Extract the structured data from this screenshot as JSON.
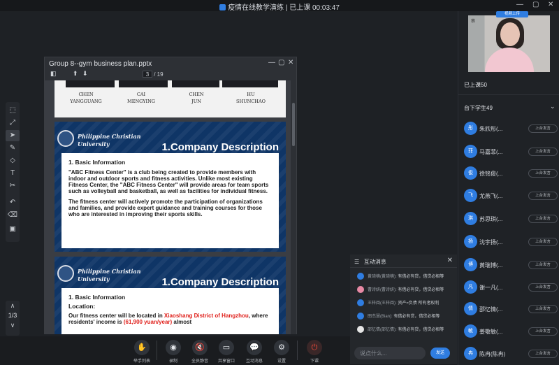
{
  "window": {
    "title": "疫情在线教学演练 | 已上课 00:03:47",
    "min": "—",
    "restore": "▢",
    "close": "✕"
  },
  "doc": {
    "title": "Group 8--gym business plan.pptx",
    "page_current": "3",
    "page_total": "/ 19",
    "min": "—",
    "max": "▢",
    "close": "✕",
    "people": [
      {
        "first": "CHEN",
        "last": "YANGGUANG"
      },
      {
        "first": "CAI",
        "last": "MENGYING"
      },
      {
        "first": "CHEN",
        "last": "JUN"
      },
      {
        "first": "HU",
        "last": "SHUNCHAO"
      }
    ],
    "slide2": {
      "school_line1": "Philippine Christian",
      "school_line2": "University",
      "heading": "1.Company Description",
      "sub": "1. Basic Information",
      "para1": "\"ABC Fitness Center\" is a club being created to provide members with indoor and outdoor sports and fitness activities. Unlike most existing Fitness Center, the \"ABC Fitness Center\" will provide areas for team sports such as volleyball and basketball, as well as facilities for individual fitness.",
      "para2": "The fitness center will actively promote the participation of organizations and families, and provide expert guidance and training courses for those who are interested in improving their sports skills."
    },
    "slide3": {
      "school_line1": "Philippine Christian",
      "school_line2": "University",
      "heading": "1.Company Description",
      "sub": "1. Basic Information",
      "location": "Location:",
      "text_a": "Our fitness center will be located in ",
      "text_b": "Xiaoshang District of Hangzhou",
      "text_c": ", where residents' income is ",
      "text_d": "(61,900 yuan/year)",
      "text_e": " almost"
    }
  },
  "pager": {
    "up": "∧",
    "label": "1/3",
    "down": "∨"
  },
  "toolbar": [
    {
      "icon": "hand-icon",
      "glyph": "✋",
      "label": "举手列表"
    },
    {
      "icon": "record-icon",
      "glyph": "◉",
      "label": "录制"
    },
    {
      "icon": "mute-all-icon",
      "glyph": "🔇",
      "label": "全员静音"
    },
    {
      "icon": "share-screen-icon",
      "glyph": "▭",
      "label": "共享窗口"
    },
    {
      "icon": "interaction-icon",
      "glyph": "💬",
      "label": "互动消息"
    },
    {
      "icon": "settings-icon",
      "glyph": "⚙",
      "label": "设置"
    },
    {
      "icon": "end-class-icon",
      "glyph": "⏻",
      "label": "下课"
    }
  ],
  "chat": {
    "header": "互动消息",
    "placeholder": "说点什么...",
    "send": "发送",
    "messages": [
      {
        "name": "黄琦楠(黄琦楠):",
        "text": "有借必有贷，借贷必相等"
      },
      {
        "name": "曹诗妍(曹诗妍):",
        "text": "有借必有贷，借贷必相等"
      },
      {
        "name": "王梓阅(王梓阅):",
        "text": "资产=负债 所有者权利"
      },
      {
        "name": "田杰慧(Bian):",
        "text": "有借必有贷，借贷必相等"
      },
      {
        "name": "邵忆情(邵忆情):",
        "text": "有借必有贷，借贷必相等"
      }
    ]
  },
  "right": {
    "upload_tag": "视频上传",
    "video_label": "蔡",
    "in_class": "已上课50",
    "students_header": "台下学生49",
    "chevron": "⌄",
    "upbtn": "上台发言",
    "students": [
      {
        "avatar": "彤",
        "name": "朱欣彤(..."
      },
      {
        "avatar": "菲",
        "name": "马嘉菲(..."
      },
      {
        "avatar": "俊",
        "name": "徐铭俊(..."
      },
      {
        "avatar": "飞",
        "name": "尤燕飞(..."
      },
      {
        "avatar": "琪",
        "name": "苏思琪(..."
      },
      {
        "avatar": "扬",
        "name": "沈宇扬(..."
      },
      {
        "avatar": "博",
        "name": "黄瑞博(..."
      },
      {
        "avatar": "凡",
        "name": "谢一凡(..."
      },
      {
        "avatar": "情",
        "name": "邵忆情(..."
      },
      {
        "avatar": "敏",
        "name": "姜敬敏(..."
      },
      {
        "avatar": "冉",
        "name": "陈冉(陈冉)"
      }
    ]
  }
}
